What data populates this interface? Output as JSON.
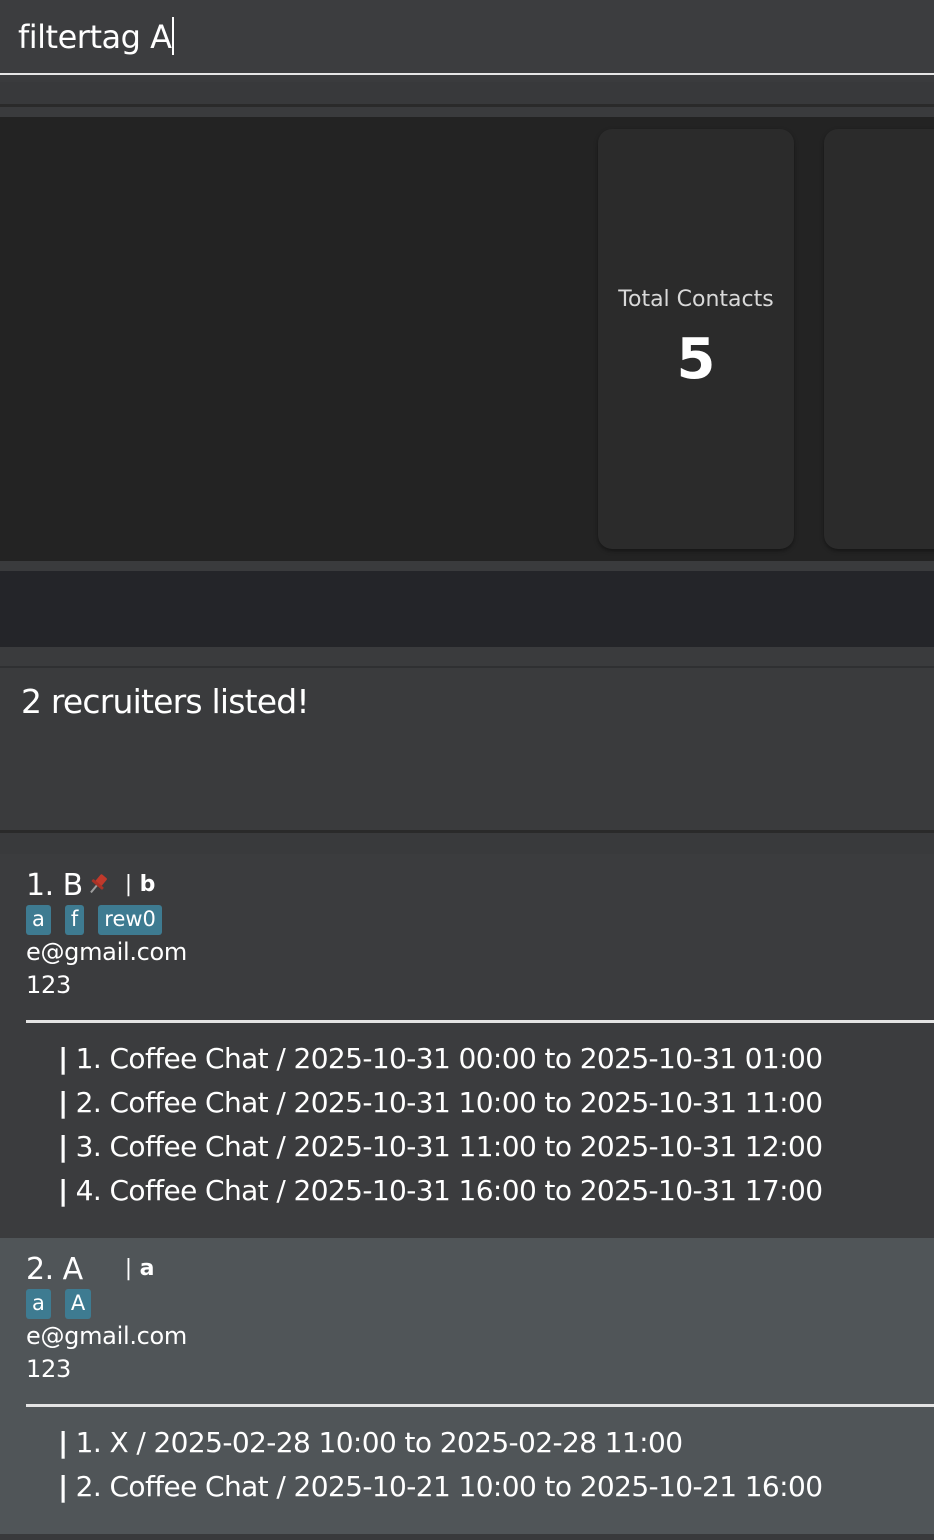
{
  "command": {
    "value": "filtertag A"
  },
  "stats": [
    {
      "title": "Total Contacts",
      "value": "5"
    },
    {
      "title": "",
      "value": ""
    }
  ],
  "result": {
    "message": "2 recruiters listed!"
  },
  "recruiters": [
    {
      "header": "1. B",
      "pinned": true,
      "separator": "|",
      "company": "b",
      "tags": [
        "a",
        "f",
        "rew0"
      ],
      "email": "e@gmail.com",
      "phone": "123",
      "events": [
        "1. Coffee Chat / 2025-10-31 00:00 to 2025-10-31 01:00",
        "2. Coffee Chat / 2025-10-31 10:00 to 2025-10-31 11:00",
        "3. Coffee Chat / 2025-10-31 11:00 to 2025-10-31 12:00",
        "4. Coffee Chat / 2025-10-31 16:00 to 2025-10-31 17:00"
      ]
    },
    {
      "header": "2. A",
      "pinned": false,
      "separator": "|",
      "company": "a",
      "tags": [
        "a",
        "A"
      ],
      "email": "e@gmail.com",
      "phone": "123",
      "events": [
        "1. X / 2025-02-28 10:00 to 2025-02-28 11:00",
        "2. Coffee Chat / 2025-10-21 10:00 to 2025-10-21 16:00"
      ]
    }
  ],
  "colors": {
    "tag": "#3e7b91",
    "pin": "#c0392b",
    "selected_card": "#505558"
  },
  "icons": {
    "pin": "pushpin-icon",
    "event_marker": "vertical-bar"
  }
}
